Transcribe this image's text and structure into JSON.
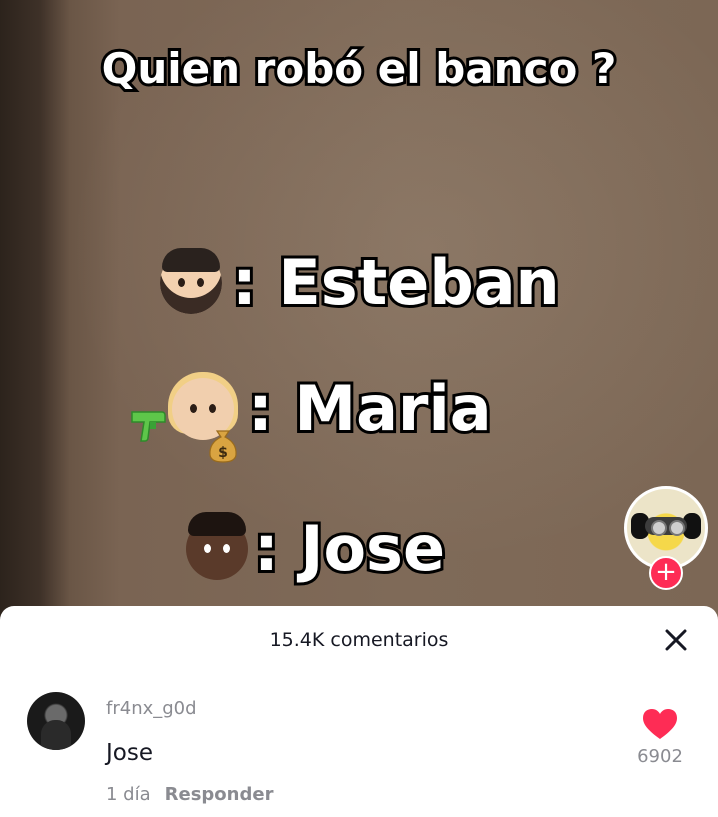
{
  "video": {
    "title": "Quien robó el banco ?",
    "options": [
      {
        "name": ": Esteban",
        "emoji": "bearded-man-emoji"
      },
      {
        "name": ": Maria",
        "emoji": "blonde-woman-emoji"
      },
      {
        "name": ": Jose",
        "emoji": "dark-skin-man-emoji"
      }
    ],
    "follow_symbol": "+"
  },
  "comments": {
    "count_label": "15.4K comentarios",
    "items": [
      {
        "username": "fr4nx_g0d",
        "text": "Jose",
        "time": "1 día",
        "reply_label": "Responder",
        "likes": "6902"
      }
    ]
  },
  "colors": {
    "accent": "#fe2c55",
    "like": "#fe2c55"
  }
}
